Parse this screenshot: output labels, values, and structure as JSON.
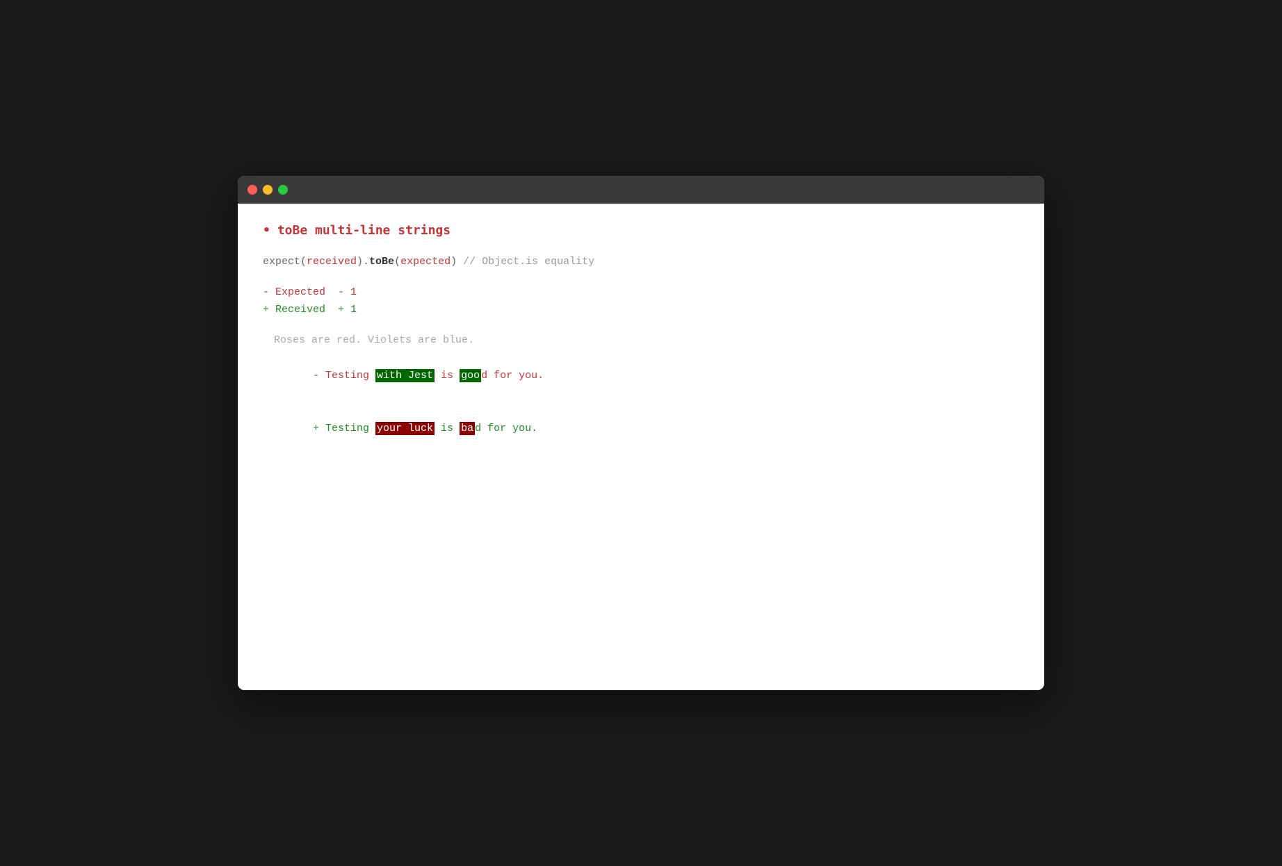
{
  "window": {
    "titlebar": {
      "close_label": "close",
      "minimize_label": "minimize",
      "maximize_label": "maximize"
    }
  },
  "content": {
    "test_title": "toBe multi-line strings",
    "expect_line": "expect(received).toBe(expected) // Object.is equality",
    "diff_minus_expected": "- Expected  - 1",
    "diff_plus_received": "+ Received  + 1",
    "context_line": "Roses are red. Violets are blue.",
    "expected_line_prefix": "- Testing ",
    "expected_line_highlight": "with Jest",
    "expected_line_mid": " is ",
    "expected_line_good": "goo",
    "expected_line_suffix1": "d for you.",
    "received_line_prefix": "+ Testing ",
    "received_line_highlight": "your luck",
    "received_line_mid": " is ",
    "received_line_bad": "ba",
    "received_line_suffix2": "d for you."
  },
  "colors": {
    "background": "#1a1a1a",
    "window_bg": "#ffffff",
    "titlebar_bg": "#3a3a3a",
    "close": "#ff5f57",
    "minimize": "#ffbd2e",
    "maximize": "#28ca41",
    "red_text": "#cc3333",
    "green_text": "#228b22",
    "gray_text": "#aaaaaa",
    "dark_text": "#333333",
    "highlight_green": "#006600",
    "highlight_red": "#8b0000"
  }
}
